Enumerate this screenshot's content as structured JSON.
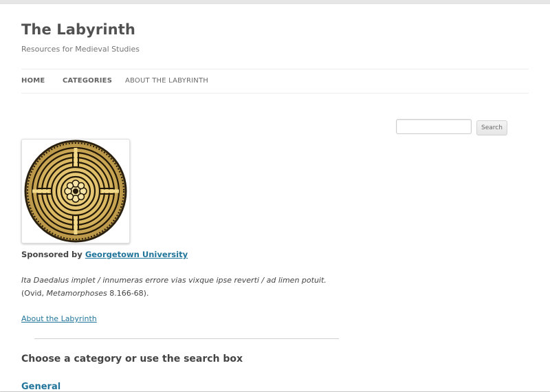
{
  "site": {
    "title": "The Labyrinth",
    "description": "Resources for Medieval Studies"
  },
  "nav": {
    "items": [
      {
        "label": "HOME"
      },
      {
        "label": "CATEGORIES"
      },
      {
        "label": "ABOUT THE LABYRINTH"
      }
    ]
  },
  "search": {
    "placeholder": "",
    "button_label": "Search"
  },
  "logo": {
    "icon": "labyrinth-logo"
  },
  "content": {
    "sponsor_prefix": "Sponsored by",
    "sponsor_link": "Georgetown University",
    "quote": "Ita Daedalus implet / innumeras errore vias vixque ipse reverti / ad limen potuit.",
    "cite_prefix": "(Ovid, ",
    "cite_work": "Metamorphoses",
    "cite_suffix": " 8.166-68).",
    "about_link": "About the Labyrinth",
    "heading": "Choose a category or use the search box",
    "first_category": "General"
  },
  "colors": {
    "link": "#21759b",
    "text": "#444444",
    "background": "#ffffff"
  }
}
